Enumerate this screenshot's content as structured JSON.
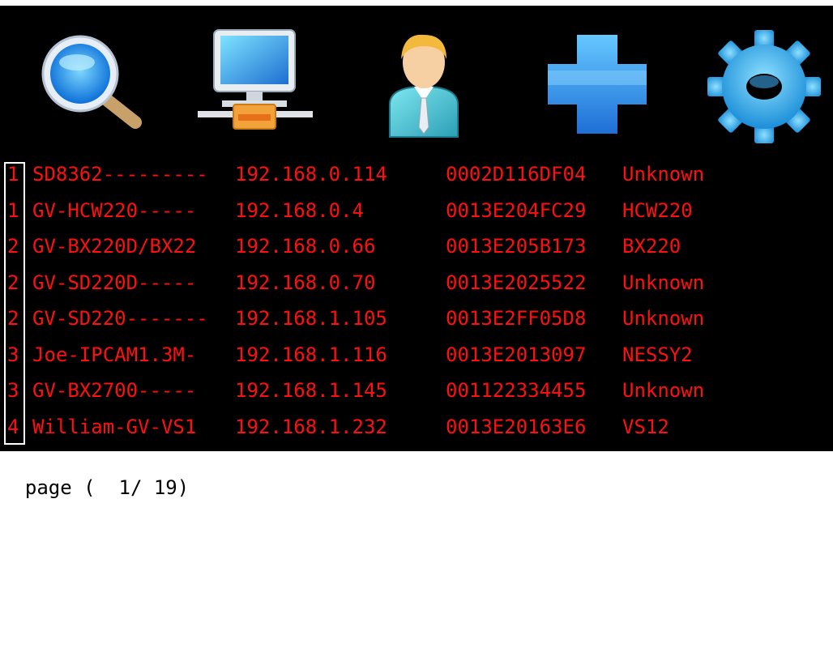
{
  "toolbar": {
    "items": [
      {
        "name": "search",
        "icon": "magnifier-icon"
      },
      {
        "name": "network",
        "icon": "network-computer-icon"
      },
      {
        "name": "user",
        "icon": "user-icon"
      },
      {
        "name": "add",
        "icon": "plus-icon"
      },
      {
        "name": "settings",
        "icon": "gear-icon"
      }
    ]
  },
  "devices": [
    {
      "idx": "1",
      "name": "SD8362---------",
      "ip": "192.168.0.114",
      "mac": "0002D116DF04",
      "model": "Unknown"
    },
    {
      "idx": "1",
      "name": "GV-HCW220-----",
      "ip": "192.168.0.4",
      "mac": "0013E204FC29",
      "model": "HCW220"
    },
    {
      "idx": "2",
      "name": "GV-BX220D/BX22",
      "ip": "192.168.0.66",
      "mac": "0013E205B173",
      "model": "BX220"
    },
    {
      "idx": "2",
      "name": "GV-SD220D-----",
      "ip": "192.168.0.70",
      "mac": "0013E2025522",
      "model": "Unknown"
    },
    {
      "idx": "2",
      "name": "GV-SD220-------",
      "ip": "192.168.1.105",
      "mac": "0013E2FF05D8",
      "model": "Unknown"
    },
    {
      "idx": "3",
      "name": "Joe-IPCAM1.3M-",
      "ip": "192.168.1.116",
      "mac": "0013E2013097",
      "model": "NESSY2"
    },
    {
      "idx": "3",
      "name": "GV-BX2700-----",
      "ip": "192.168.1.145",
      "mac": "001122334455",
      "model": "Unknown"
    },
    {
      "idx": "4",
      "name": "William-GV-VS1",
      "ip": "192.168.1.232",
      "mac": "0013E20163E6",
      "model": "VS12"
    }
  ],
  "pager": {
    "label": "page (  1/ 19)"
  },
  "colors": {
    "text": "#ff1010",
    "background": "#000000",
    "footer_bg": "#ffffff"
  }
}
